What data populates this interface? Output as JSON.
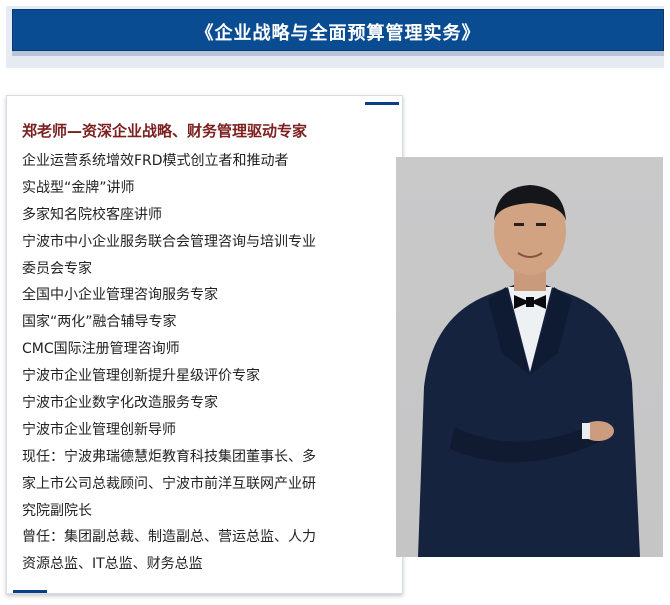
{
  "banner": {
    "title": "《企业战略与全面预算管理实务》"
  },
  "bio": {
    "heading": "郑老师—资深企业战略、财务管理驱动专家",
    "lines": [
      "企业运营系统增效FRD模式创立者和推动者",
      "实战型“金牌”讲师",
      "多家知名院校客座讲师",
      "宁波市中小企业服务联合会管理咨询与培训专业",
      "委员会专家",
      "全国中小企业管理咨询服务专家",
      "国家“两化”融合辅导专家",
      "CMC国际注册管理咨询师",
      "宁波市企业管理创新提升星级评价专家",
      "宁波市企业数字化改造服务专家",
      "宁波市企业管理创新导师",
      "现任：宁波弗瑞德慧炬教育科技集团董事长、多",
      "家上市公司总裁顾问、宁波市前洋互联网产业研",
      "究院副院长",
      "曾任：集团副总裁、制造副总、营运总监、人力",
      "资源总监、IT总监、财务总监"
    ]
  },
  "colors": {
    "banner": "#0a4c92",
    "heading": "#7d1f1f",
    "accent": "#0a3f86"
  }
}
